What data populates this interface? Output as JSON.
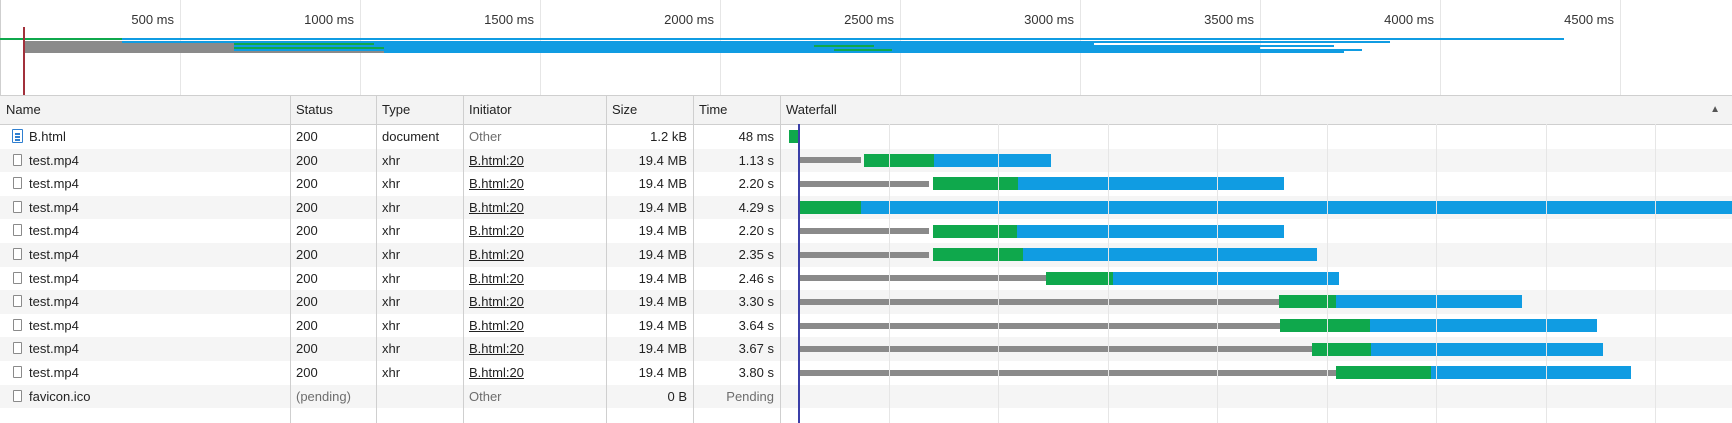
{
  "overview": {
    "ticks": [
      "500 ms",
      "1000 ms",
      "1500 ms",
      "2000 ms",
      "2500 ms",
      "3000 ms",
      "3500 ms",
      "4000 ms",
      "4500 ms"
    ]
  },
  "columns": {
    "name": "Name",
    "status": "Status",
    "type": "Type",
    "initiator": "Initiator",
    "size": "Size",
    "time": "Time",
    "waterfall": "Waterfall"
  },
  "sort_indicator": "▲",
  "rows": [
    {
      "name": "B.html",
      "status": "200",
      "type": "document",
      "initiator": "Other",
      "size": "1.2 kB",
      "time": "48 ms",
      "icon": "html-document-icon"
    },
    {
      "name": "test.mp4",
      "status": "200",
      "type": "xhr",
      "initiator": "B.html:20",
      "size": "19.4 MB",
      "time": "1.13 s",
      "icon": "file-icon"
    },
    {
      "name": "test.mp4",
      "status": "200",
      "type": "xhr",
      "initiator": "B.html:20",
      "size": "19.4 MB",
      "time": "2.20 s",
      "icon": "file-icon"
    },
    {
      "name": "test.mp4",
      "status": "200",
      "type": "xhr",
      "initiator": "B.html:20",
      "size": "19.4 MB",
      "time": "4.29 s",
      "icon": "file-icon"
    },
    {
      "name": "test.mp4",
      "status": "200",
      "type": "xhr",
      "initiator": "B.html:20",
      "size": "19.4 MB",
      "time": "2.20 s",
      "icon": "file-icon"
    },
    {
      "name": "test.mp4",
      "status": "200",
      "type": "xhr",
      "initiator": "B.html:20",
      "size": "19.4 MB",
      "time": "2.35 s",
      "icon": "file-icon"
    },
    {
      "name": "test.mp4",
      "status": "200",
      "type": "xhr",
      "initiator": "B.html:20",
      "size": "19.4 MB",
      "time": "2.46 s",
      "icon": "file-icon"
    },
    {
      "name": "test.mp4",
      "status": "200",
      "type": "xhr",
      "initiator": "B.html:20",
      "size": "19.4 MB",
      "time": "3.30 s",
      "icon": "file-icon"
    },
    {
      "name": "test.mp4",
      "status": "200",
      "type": "xhr",
      "initiator": "B.html:20",
      "size": "19.4 MB",
      "time": "3.64 s",
      "icon": "file-icon"
    },
    {
      "name": "test.mp4",
      "status": "200",
      "type": "xhr",
      "initiator": "B.html:20",
      "size": "19.4 MB",
      "time": "3.67 s",
      "icon": "file-icon"
    },
    {
      "name": "test.mp4",
      "status": "200",
      "type": "xhr",
      "initiator": "B.html:20",
      "size": "19.4 MB",
      "time": "3.80 s",
      "icon": "file-icon"
    },
    {
      "name": "favicon.ico",
      "status": "(pending)",
      "type": "",
      "initiator": "Other",
      "size": "0 B",
      "time": "Pending",
      "icon": "file-icon"
    }
  ],
  "colors": {
    "queued": "#8a8a8a",
    "waiting": "#0fa84c",
    "download": "#109ce2",
    "load_marker": "#a2303b",
    "dom_marker": "#3b3fa8"
  }
}
